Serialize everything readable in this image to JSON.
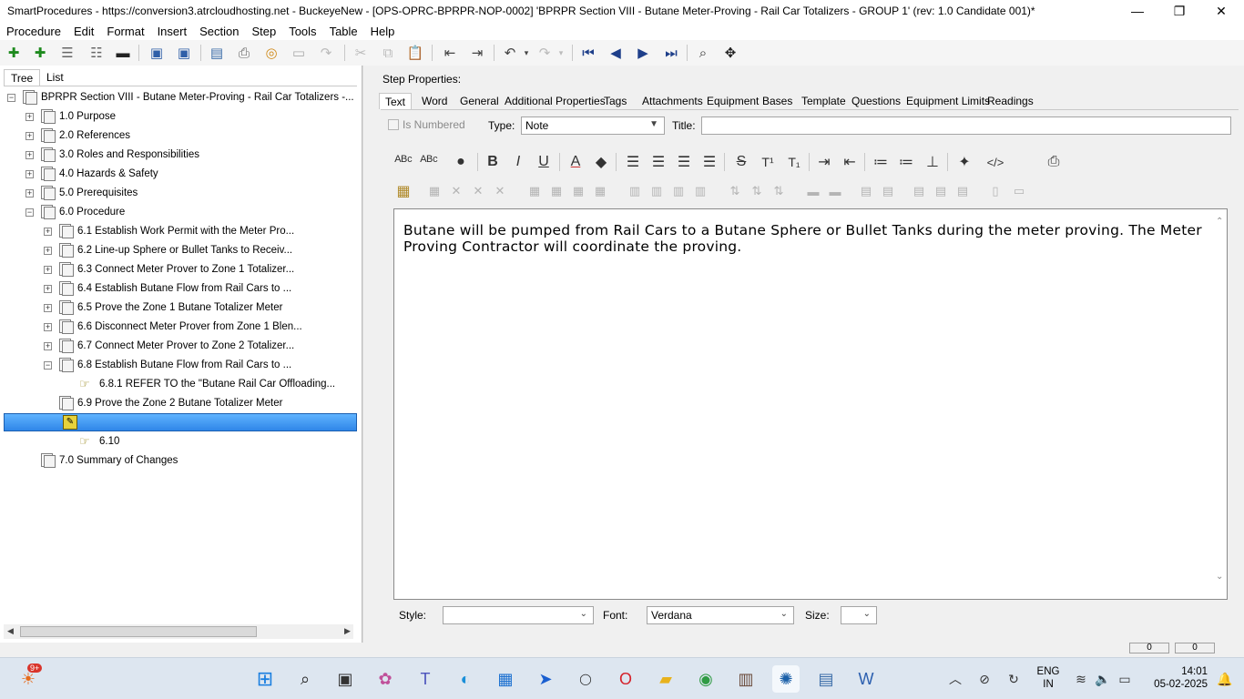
{
  "window": {
    "title": "SmartProcedures - https://conversion3.atrcloudhosting.net - BuckeyeNew - [OPS-OPRC-BPRPR-NOP-0002] 'BPRPR Section VIII - Butane Meter-Proving - Rail Car Totalizers - GROUP 1' (rev: 1.0 Candidate 001)*",
    "minimize": "—",
    "maximize": "❐",
    "close": "✕"
  },
  "menu": [
    "Procedure",
    "Edit",
    "Format",
    "Insert",
    "Section",
    "Step",
    "Tools",
    "Table",
    "Help"
  ],
  "left_tabs": [
    "Tree",
    "List"
  ],
  "tree": {
    "root": "BPRPR Section VIII - Butane Meter-Proving - Rail Car Totalizers -...",
    "items": [
      {
        "label": "1.0 Purpose"
      },
      {
        "label": "2.0 References"
      },
      {
        "label": "3.0 Roles and Responsibilities"
      },
      {
        "label": "4.0 Hazards & Safety"
      },
      {
        "label": "5.0 Prerequisites"
      },
      {
        "label": "6.0 Procedure"
      },
      {
        "label": "6.1 Establish Work Permit with the Meter Pro..."
      },
      {
        "label": "6.2 Line-up Sphere or Bullet Tanks to Receiv..."
      },
      {
        "label": "6.3 Connect Meter Prover to Zone 1 Totalizer..."
      },
      {
        "label": "6.4 Establish Butane Flow from Rail Cars to ..."
      },
      {
        "label": "6.5 Prove the Zone 1 Butane Totalizer Meter"
      },
      {
        "label": "6.6 Disconnect Meter Prover from Zone 1 Blen..."
      },
      {
        "label": "6.7 Connect Meter Prover to Zone 2 Totalizer..."
      },
      {
        "label": "6.8 Establish Butane Flow from Rail Cars to ..."
      },
      {
        "label": "6.8.1 REFER TO the \"Butane Rail Car Offloading..."
      },
      {
        "label": "6.9 Prove the Zone 2 Butane Totalizer Meter"
      },
      {
        "label": ""
      },
      {
        "label": "6.10"
      },
      {
        "label": "7.0 Summary of Changes"
      }
    ],
    "expanders": {
      "plus": "+",
      "minus": "−"
    }
  },
  "step_properties": {
    "heading": "Step Properties:",
    "tabs": [
      "Text",
      "Word",
      "General",
      "Additional Properties",
      "Tags",
      "Attachments",
      "Equipment",
      "Bases",
      "Template",
      "Questions",
      "Equipment Limits",
      "Readings"
    ],
    "is_numbered_label": "Is Numbered",
    "type_label": "Type:",
    "type_value": "Note",
    "title_label": "Title:",
    "title_value": "",
    "body_text": "Butane will be pumped from Rail Cars to a Butane Sphere or Bullet Tanks during the meter proving. The Meter Proving Contractor will coordinate the proving.",
    "style_label": "Style:",
    "style_value": "",
    "font_label": "Font:",
    "font_value": "Verdana",
    "size_label": "Size:",
    "size_value": ""
  },
  "format_toolbar": {
    "bold": "B",
    "italic": "I",
    "underline": "U",
    "strike": "S",
    "superscript": "T¹",
    "subscript": "T₁",
    "html": "</>"
  },
  "status": {
    "left_box": "0",
    "right_box": "0"
  },
  "taskbar": {
    "badge": "9+",
    "lang_line1": "ENG",
    "lang_line2": "IN",
    "time": "14:01",
    "date": "05-02-2025"
  }
}
